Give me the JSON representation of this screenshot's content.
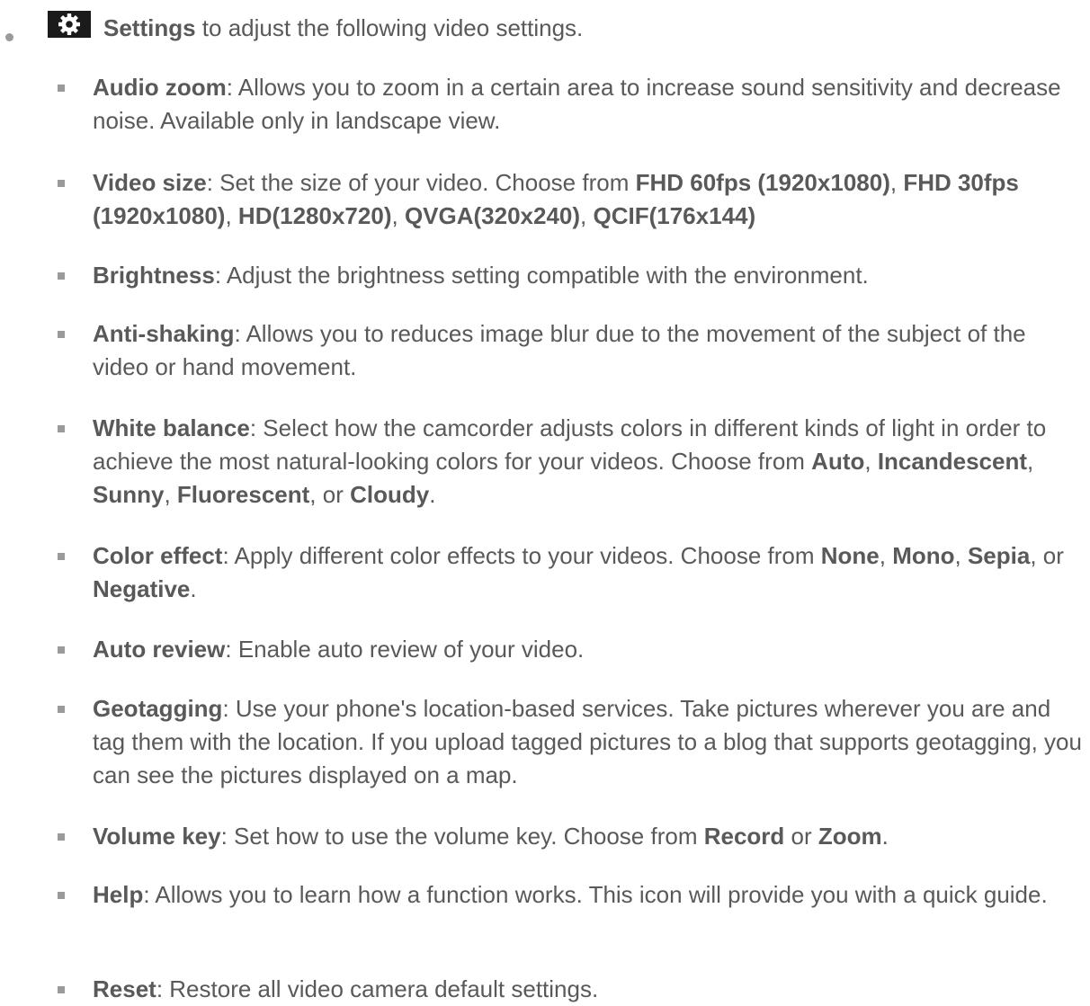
{
  "intro": {
    "icon": "gear-icon",
    "bold": "Settings",
    "rest": " to adjust the following video settings."
  },
  "items": [
    {
      "parts": [
        {
          "b": "Audio zoom"
        },
        {
          "t": ": Allows you to zoom in a certain area to increase sound sensitivity and decrease noise. Available only in landscape view."
        }
      ]
    },
    {
      "parts": [
        {
          "b": "Video size"
        },
        {
          "t": ": Set the size of your video. Choose from "
        },
        {
          "b": "FHD 60fps (1920x1080)"
        },
        {
          "t": ", "
        },
        {
          "b": "FHD 30fps (1920x1080)"
        },
        {
          "t": ", "
        },
        {
          "b": "HD(1280x720)"
        },
        {
          "t": ", "
        },
        {
          "b": "QVGA(320x240)"
        },
        {
          "t": ", "
        },
        {
          "b": "QCIF(176x144)"
        }
      ]
    },
    {
      "parts": [
        {
          "b": "Brightness"
        },
        {
          "t": ": Adjust the brightness setting compatible with the environment."
        }
      ]
    },
    {
      "parts": [
        {
          "b": "Anti-shaking"
        },
        {
          "t": ": Allows you to reduces image blur due to the movement of the subject of the video or hand movement."
        }
      ]
    },
    {
      "parts": [
        {
          "b": "White balance"
        },
        {
          "t": ": Select how the camcorder adjusts colors in different kinds of light in order to achieve the most natural-looking colors for your videos. Choose from "
        },
        {
          "b": "Auto"
        },
        {
          "t": ", "
        },
        {
          "b": "Incandescent"
        },
        {
          "t": ", "
        },
        {
          "b": "Sunny"
        },
        {
          "t": ", "
        },
        {
          "b": "Fluorescent"
        },
        {
          "t": ", or "
        },
        {
          "b": "Cloudy"
        },
        {
          "t": "."
        }
      ]
    },
    {
      "parts": [
        {
          "b": "Color effect"
        },
        {
          "t": ": Apply different color effects to your videos. Choose from "
        },
        {
          "b": "None"
        },
        {
          "t": ", "
        },
        {
          "b": "Mono"
        },
        {
          "t": ", "
        },
        {
          "b": "Sepia"
        },
        {
          "t": ", or "
        },
        {
          "b": "Negative"
        },
        {
          "t": "."
        }
      ]
    },
    {
      "parts": [
        {
          "b": "Auto review"
        },
        {
          "t": ": Enable auto review of your video."
        }
      ]
    },
    {
      "parts": [
        {
          "b": "Geotagging"
        },
        {
          "t": ": Use your phone's location-based services. Take pictures wherever you are and tag them with the location. If you upload tagged pictures to a blog that supports geotagging, you can see the pictures displayed on a map."
        }
      ]
    },
    {
      "parts": [
        {
          "b": "Volume key"
        },
        {
          "t": ": Set how to use the volume key. Choose from "
        },
        {
          "b": "Record"
        },
        {
          "t": " or "
        },
        {
          "b": "Zoom"
        },
        {
          "t": "."
        }
      ]
    },
    {
      "parts": [
        {
          "b": "Help"
        },
        {
          "t": ": Allows you to learn how a function works. This icon will provide you with a quick guide."
        }
      ]
    },
    {
      "parts": [
        {
          "b": "Reset"
        },
        {
          "t": ": Restore all video camera default settings."
        }
      ]
    }
  ]
}
